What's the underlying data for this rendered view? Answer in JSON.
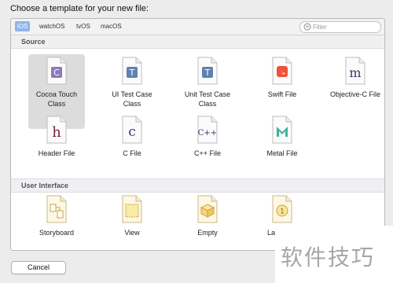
{
  "dialog": {
    "heading": "Choose a template for your new file:",
    "cancel_label": "Cancel"
  },
  "platform_tabs": [
    "iOS",
    "watchOS",
    "tvOS",
    "macOS"
  ],
  "active_tab": "iOS",
  "filter": {
    "placeholder": "Filter",
    "value": ""
  },
  "sections": [
    {
      "title": "Source",
      "items": [
        {
          "label": "Cocoa Touch\nClass",
          "icon": "cocoa-touch-class-icon",
          "selected": true
        },
        {
          "label": "UI Test Case\nClass",
          "icon": "ui-test-case-class-icon"
        },
        {
          "label": "Unit Test Case\nClass",
          "icon": "unit-test-case-class-icon"
        },
        {
          "label": "Swift File",
          "icon": "swift-file-icon"
        },
        {
          "label": "Objective-C File",
          "icon": "objective-c-file-icon"
        },
        {
          "label": "Header File",
          "icon": "header-file-icon"
        },
        {
          "label": "C File",
          "icon": "c-file-icon"
        },
        {
          "label": "C++ File",
          "icon": "cpp-file-icon"
        },
        {
          "label": "Metal File",
          "icon": "metal-file-icon"
        }
      ]
    },
    {
      "title": "User Interface",
      "items": [
        {
          "label": "Storyboard",
          "icon": "storyboard-icon"
        },
        {
          "label": "View",
          "icon": "view-icon"
        },
        {
          "label": "Empty",
          "icon": "empty-icon"
        },
        {
          "label": "Launch S",
          "icon": "launch-screen-icon"
        }
      ]
    }
  ],
  "glyphs": {
    "c": "C",
    "t": "T",
    "m": "m",
    "h": "h",
    "c_lower": "c",
    "cpp": "C++",
    "one": "1"
  },
  "watermark": "软件技巧",
  "colors": {
    "selection": "#dcdcdc",
    "active_tab": "#8fb4e8",
    "swift": "#f05138",
    "metal": "#3fb3a0",
    "class_icon": "#8c79b8"
  }
}
